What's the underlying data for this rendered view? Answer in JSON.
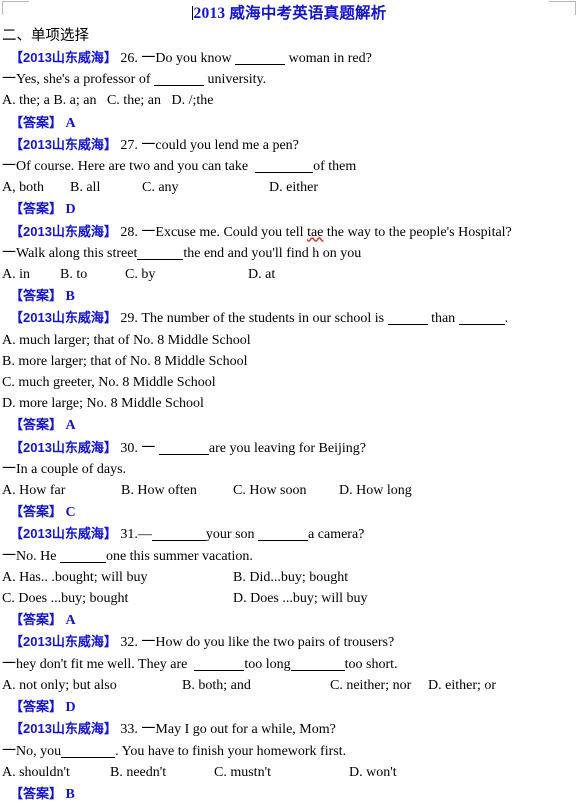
{
  "document": {
    "title": "2013 威海中考英语真题解析",
    "section_heading": "二、单项选择",
    "source_tag": "【2013山东威海】",
    "answer_label": "【答案】"
  },
  "questions": [
    {
      "number": "26.",
      "stem_prefix": "一Do you know ",
      "stem_suffix": " woman in red?",
      "reply": "一Yes, she's a professor of ",
      "reply_suffix": " university.",
      "options_line": "A. the; a B. a; an   C. the; an   D. /;the",
      "answer": "A"
    },
    {
      "number": "27.",
      "stem": "一could you lend me a pen?",
      "reply_prefix": "一Of course. Here are two and you can take  ",
      "reply_suffix": "of them",
      "options": [
        "A, both",
        "B. all",
        "C. any",
        "D. either"
      ],
      "answer": "D"
    },
    {
      "number": "28.",
      "stem_a": "一Excuse me. Could you tell ",
      "stem_misspelled": "tae",
      "stem_b": " the way to the people's Hospital?",
      "reply_prefix": "一Walk along this street",
      "reply_suffix": "the end and you'll find h on you",
      "options": [
        "A. in",
        "B. to",
        "C. by",
        "D. at"
      ],
      "answer": "B"
    },
    {
      "number": "29.",
      "stem_a": "The number of the students in our school is ",
      "stem_b": " than ",
      "stem_c": ".",
      "options_stacked": [
        "A. much larger; that of No. 8 Middle School",
        "B. more larger; that of No. 8 Middle School",
        "C. much greeter, No. 8 Middle School",
        "D. more large; No. 8 Middle School"
      ],
      "answer": "A"
    },
    {
      "number": "30.",
      "stem_prefix": "一 ",
      "stem_suffix": "are you leaving for Beijing?",
      "reply": "一In a couple of days.",
      "options": [
        "A. How far",
        "B. How often",
        "C. How soon",
        "D. How long"
      ],
      "answer": "C"
    },
    {
      "number": "31.—",
      "stem_mid": "your son ",
      "stem_suffix": "a camera?",
      "reply_prefix": "一No. He ",
      "reply_suffix": "one this summer vacation.",
      "options_grid": [
        [
          "A. Has.. .bought; will buy",
          "B. Did...buy; bought"
        ],
        [
          "C. Does ...buy; bought",
          "D. Does ...buy; will buy"
        ]
      ],
      "answer": "A"
    },
    {
      "number": "32.",
      "stem": "一How do you like the two pairs of trousers?",
      "reply_a": "一hey don't fit me well. They are  ",
      "reply_b": "too long",
      "reply_c": "too short.",
      "options": [
        "A. not only; but also",
        "B. both; and",
        "C. neither; nor",
        "D. either; or"
      ],
      "answer": "D"
    },
    {
      "number": "33.",
      "stem": "一May I go out for a while, Mom?",
      "reply_prefix": "一No, you",
      "reply_suffix": ". You have to finish your homework first.",
      "options": [
        "A. shouldn't",
        "B. needn't",
        "C. mustn't",
        "D. won't"
      ],
      "answer": "B"
    }
  ],
  "colors": {
    "accent_blue": "#1414c8",
    "text_black": "#000000",
    "spellcheck_red": "#d03020",
    "crop_mark_gray": "#b8b8b8"
  }
}
